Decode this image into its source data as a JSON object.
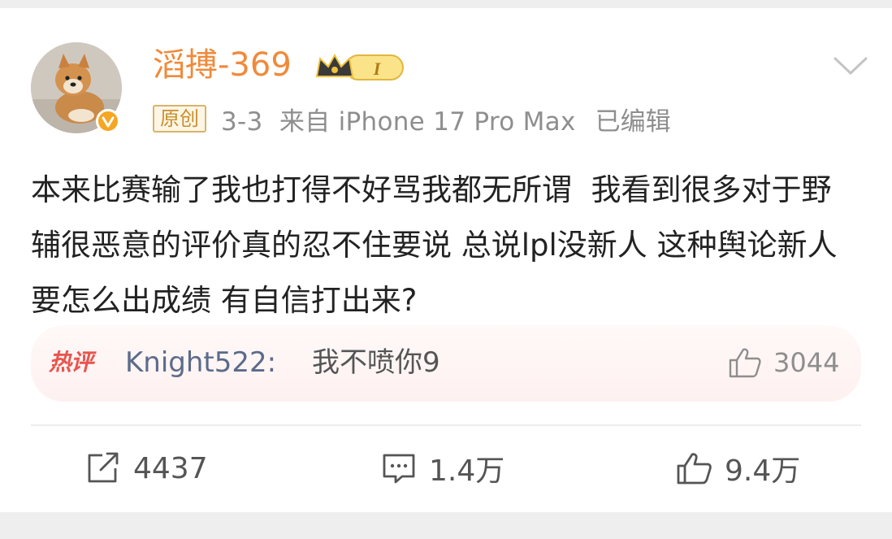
{
  "post": {
    "author": "滔搏-369",
    "original_tag": "原创",
    "meta": "3-3  来自 iPhone 17 Pro Max",
    "edited": "已编辑",
    "text": "本来比赛输了我也打得不好骂我都无所谓  我看到很多对于野辅很恶意的评价真的忍不住要说 总说lpl没新人 这种舆论新人要怎么出成绩 有自信打出来?",
    "level_label": "I"
  },
  "hot_comment": {
    "tag": "热评",
    "author": "Knight522:",
    "text": "我不喷你9",
    "likes": "3044"
  },
  "actions": {
    "repost_count": "4437",
    "comment_count": "1.4万",
    "like_count": "9.4万"
  },
  "icons": {
    "verified": "verified-badge-icon",
    "crown": "crown-icon",
    "chevron": "chevron-down-icon",
    "repost": "repost-icon",
    "comment": "comment-icon",
    "like": "thumbs-up-icon"
  },
  "colors": {
    "author_name": "#f08a3a",
    "hot_tag": "#e8544e",
    "hot_author": "#5b6b8a",
    "verified": "#f5a623"
  }
}
